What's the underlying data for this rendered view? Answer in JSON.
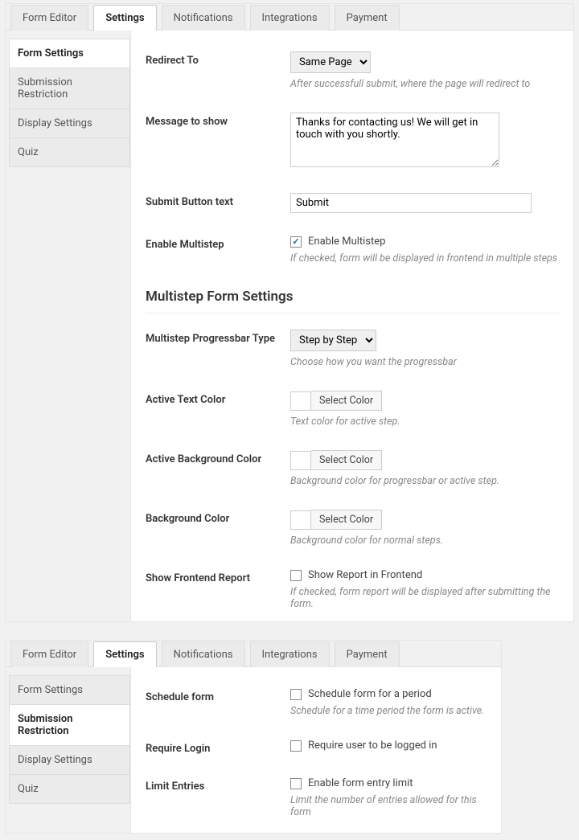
{
  "block1": {
    "tabs": [
      "Form Editor",
      "Settings",
      "Notifications",
      "Integrations",
      "Payment"
    ],
    "active_tab": 1,
    "sidebar": [
      "Form Settings",
      "Submission Restriction",
      "Display Settings",
      "Quiz"
    ],
    "active_side": 0,
    "redirect": {
      "label": "Redirect To",
      "value": "Same Page",
      "hint": "After successfull submit, where the page will redirect to"
    },
    "message": {
      "label": "Message to show",
      "value": "Thanks for contacting us! We will get in touch with you shortly."
    },
    "submit_btn": {
      "label": "Submit Button text",
      "value": "Submit"
    },
    "enable_ms": {
      "label": "Enable Multistep",
      "chk_label": "Enable Multistep",
      "checked": true,
      "hint": "If checked, form will be displayed in frontend in multiple steps"
    },
    "ms_heading": "Multistep Form Settings",
    "ms_type": {
      "label": "Multistep Progressbar Type",
      "value": "Step by Step",
      "hint": "Choose how you want the progressbar"
    },
    "active_text": {
      "label": "Active Text Color",
      "btn": "Select Color",
      "hint": "Text color for active step."
    },
    "active_bg": {
      "label": "Active Background Color",
      "btn": "Select Color",
      "hint": "Background color for progressbar or active step."
    },
    "bg": {
      "label": "Background Color",
      "btn": "Select Color",
      "hint": "Background color for normal steps."
    },
    "report": {
      "label": "Show Frontend Report",
      "chk_label": "Show Report in Frontend",
      "checked": false,
      "hint": "If checked, form report will be displayed after submitting the form."
    }
  },
  "block2": {
    "tabs": [
      "Form Editor",
      "Settings",
      "Notifications",
      "Integrations",
      "Payment"
    ],
    "active_tab": 1,
    "sidebar": [
      "Form Settings",
      "Submission Restriction",
      "Display Settings",
      "Quiz"
    ],
    "active_side": 1,
    "schedule": {
      "label": "Schedule form",
      "chk_label": "Schedule form for a period",
      "checked": false,
      "hint": "Schedule for a time period the form is active."
    },
    "login": {
      "label": "Require Login",
      "chk_label": "Require user to be logged in",
      "checked": false
    },
    "limit": {
      "label": "Limit Entries",
      "chk_label": "Enable form entry limit",
      "checked": false,
      "hint": "Limit the number of entries allowed for this form"
    }
  }
}
